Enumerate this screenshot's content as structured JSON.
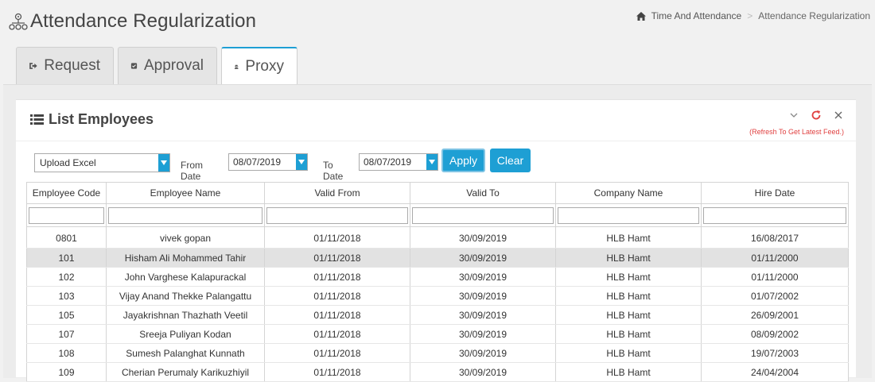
{
  "header": {
    "title": "Attendance Regularization",
    "breadcrumb": [
      "Time And Attendance",
      "Attendance Regularization"
    ]
  },
  "tabs": [
    {
      "label": "Request",
      "icon": "sign-out-icon"
    },
    {
      "label": "Approval",
      "icon": "check-square-icon"
    },
    {
      "label": "Proxy",
      "icon": "user-secret-icon",
      "active": true
    }
  ],
  "box": {
    "title": "List Employees",
    "refresh_note": "(Refresh To Get Latest Feed.)"
  },
  "filters": {
    "upload_select": "Upload Excel",
    "from_label": "From Date",
    "from_value": "08/07/2019",
    "to_label": "To Date",
    "to_value": "08/07/2019",
    "apply_label": "Apply",
    "clear_label": "Clear"
  },
  "table": {
    "columns": [
      "Employee Code",
      "Employee Name",
      "Valid From",
      "Valid To",
      "Company Name",
      "Hire Date"
    ],
    "rows": [
      [
        "0801",
        "vivek gopan",
        "01/11/2018",
        "30/09/2019",
        "HLB Hamt",
        "16/08/2017"
      ],
      [
        "101",
        "Hisham Ali Mohammed Tahir",
        "01/11/2018",
        "30/09/2019",
        "HLB Hamt",
        "01/11/2000"
      ],
      [
        "102",
        "John Varghese Kalapurackal",
        "01/11/2018",
        "30/09/2019",
        "HLB Hamt",
        "01/11/2000"
      ],
      [
        "103",
        "Vijay Anand Thekke Palangattu",
        "01/11/2018",
        "30/09/2019",
        "HLB Hamt",
        "01/07/2002"
      ],
      [
        "105",
        "Jayakrishnan Thazhath Veetil",
        "01/11/2018",
        "30/09/2019",
        "HLB Hamt",
        "26/09/2001"
      ],
      [
        "107",
        "Sreeja Puliyan Kodan",
        "01/11/2018",
        "30/09/2019",
        "HLB Hamt",
        "08/09/2002"
      ],
      [
        "108",
        "Sumesh Palanghat Kunnath",
        "01/11/2018",
        "30/09/2019",
        "HLB Hamt",
        "19/07/2003"
      ],
      [
        "109",
        "Cherian Perumaly Karikuzhiyil",
        "01/11/2018",
        "30/09/2019",
        "HLB Hamt",
        "24/04/2004"
      ]
    ],
    "highlighted_row": 1
  },
  "colors": {
    "accent": "#1e9fd4",
    "refresh_red": "#e04040",
    "highlight_row": "#e2e2e2"
  }
}
